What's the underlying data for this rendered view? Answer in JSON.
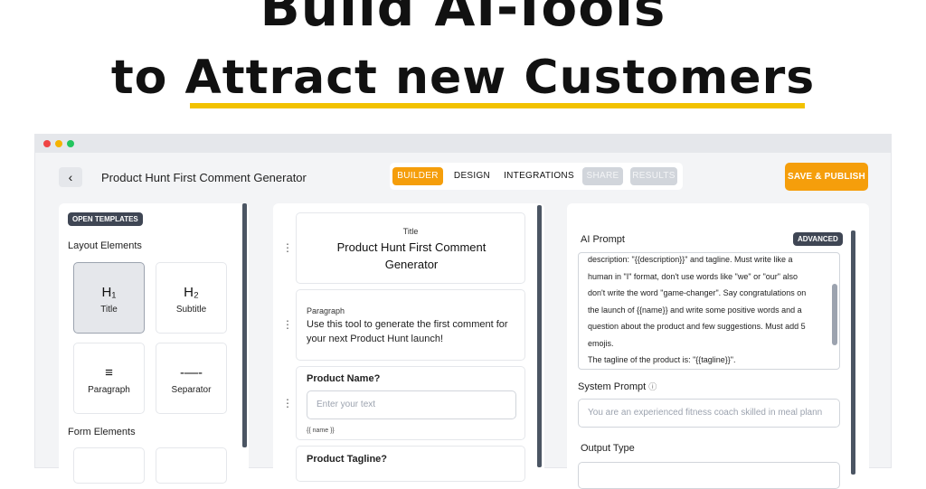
{
  "headline": {
    "line1": "Build AI-Tools",
    "line2": "to Attract new Customers"
  },
  "toolbar": {
    "back_icon": "chevron-left-icon",
    "back_label": "‹",
    "app_title": "Product Hunt First Comment Generator",
    "tabs": [
      {
        "label": "BUILDER",
        "state": "active"
      },
      {
        "label": "DESIGN",
        "state": "normal"
      },
      {
        "label": "INTEGRATIONS",
        "state": "normal"
      },
      {
        "label": "SHARE",
        "state": "disabled"
      },
      {
        "label": "RESULTS",
        "state": "disabled"
      }
    ],
    "save_label": "SAVE & PUBLISH",
    "accent": "#f59e0b"
  },
  "left": {
    "open_templates": "OPEN TEMPLATES",
    "layout_heading": "Layout Elements",
    "tiles": [
      {
        "icon": "H₁",
        "label": "Title"
      },
      {
        "icon": "H₂",
        "label": "Subtitle"
      },
      {
        "icon": "≡",
        "label": "Paragraph"
      },
      {
        "icon": "-—-",
        "label": "Separator"
      }
    ],
    "form_heading": "Form Elements"
  },
  "middle": {
    "title_block": {
      "type_label": "Title",
      "text": "Product Hunt First Comment Generator"
    },
    "paragraph_block": {
      "type_label": "Paragraph",
      "text": "Use this tool to generate the first comment for your next Product Hunt launch!"
    },
    "name_field": {
      "label": "Product Name?",
      "placeholder": "Enter your text",
      "variable": "{{ name }}"
    },
    "tagline_field": {
      "label": "Product Tagline?"
    }
  },
  "right": {
    "ai_prompt_label": "AI Prompt",
    "advanced_badge": "ADVANCED",
    "prompt_lines": [
      "description: \"{{description}}\" and tagline. Must write like a",
      "human in \"I\" format, don't use words like \"we\" or \"our\" also",
      "don't write the word \"game-changer\". Say congratulations on",
      "the launch of {{name}} and write some positive words and a",
      "question about the product and few suggestions. Must add 5",
      "emojis.",
      "The tagline of the product is: \"{{tagline}}\"."
    ],
    "system_prompt_label": "System Prompt",
    "info_icon": "ⓘ",
    "system_placeholder": "You are an experienced fitness coach skilled in meal plann",
    "output_type_label": "Output Type"
  }
}
